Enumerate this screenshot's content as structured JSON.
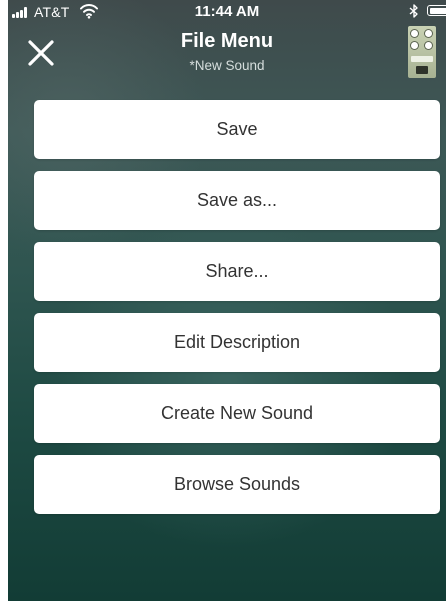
{
  "status_bar": {
    "carrier": "AT&T",
    "time": "11:44 AM",
    "icons": [
      "signal-bars-icon",
      "wifi-icon",
      "bluetooth-icon",
      "battery-icon"
    ]
  },
  "nav": {
    "title": "File Menu",
    "subtitle": "*New Sound",
    "close_icon": "close-icon",
    "device_thumbnail": "pedal-device-icon"
  },
  "menu": {
    "items": [
      {
        "label": "Save"
      },
      {
        "label": "Save as..."
      },
      {
        "label": "Share..."
      },
      {
        "label": "Edit Description"
      },
      {
        "label": "Create New Sound"
      },
      {
        "label": "Browse Sounds"
      }
    ]
  },
  "colors": {
    "background_top": "#3f4a4b",
    "background_bottom": "#123c35",
    "button_bg": "#ffffff",
    "button_text": "#333333",
    "header_text": "#ffffff"
  }
}
